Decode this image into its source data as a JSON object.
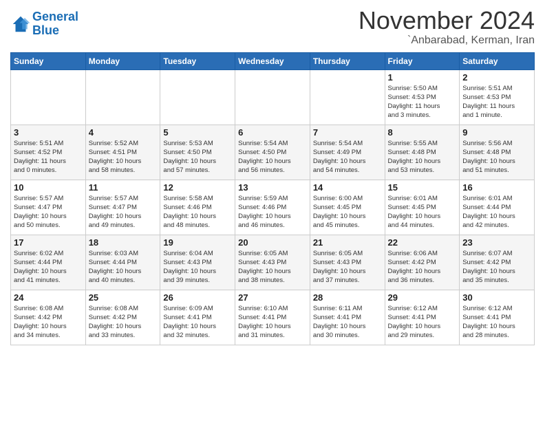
{
  "header": {
    "logo_line1": "General",
    "logo_line2": "Blue",
    "month": "November 2024",
    "location": "`Anbarabad, Kerman, Iran"
  },
  "weekdays": [
    "Sunday",
    "Monday",
    "Tuesday",
    "Wednesday",
    "Thursday",
    "Friday",
    "Saturday"
  ],
  "weeks": [
    [
      {
        "day": "",
        "info": ""
      },
      {
        "day": "",
        "info": ""
      },
      {
        "day": "",
        "info": ""
      },
      {
        "day": "",
        "info": ""
      },
      {
        "day": "",
        "info": ""
      },
      {
        "day": "1",
        "info": "Sunrise: 5:50 AM\nSunset: 4:53 PM\nDaylight: 11 hours\nand 3 minutes."
      },
      {
        "day": "2",
        "info": "Sunrise: 5:51 AM\nSunset: 4:53 PM\nDaylight: 11 hours\nand 1 minute."
      }
    ],
    [
      {
        "day": "3",
        "info": "Sunrise: 5:51 AM\nSunset: 4:52 PM\nDaylight: 11 hours\nand 0 minutes."
      },
      {
        "day": "4",
        "info": "Sunrise: 5:52 AM\nSunset: 4:51 PM\nDaylight: 10 hours\nand 58 minutes."
      },
      {
        "day": "5",
        "info": "Sunrise: 5:53 AM\nSunset: 4:50 PM\nDaylight: 10 hours\nand 57 minutes."
      },
      {
        "day": "6",
        "info": "Sunrise: 5:54 AM\nSunset: 4:50 PM\nDaylight: 10 hours\nand 56 minutes."
      },
      {
        "day": "7",
        "info": "Sunrise: 5:54 AM\nSunset: 4:49 PM\nDaylight: 10 hours\nand 54 minutes."
      },
      {
        "day": "8",
        "info": "Sunrise: 5:55 AM\nSunset: 4:48 PM\nDaylight: 10 hours\nand 53 minutes."
      },
      {
        "day": "9",
        "info": "Sunrise: 5:56 AM\nSunset: 4:48 PM\nDaylight: 10 hours\nand 51 minutes."
      }
    ],
    [
      {
        "day": "10",
        "info": "Sunrise: 5:57 AM\nSunset: 4:47 PM\nDaylight: 10 hours\nand 50 minutes."
      },
      {
        "day": "11",
        "info": "Sunrise: 5:57 AM\nSunset: 4:47 PM\nDaylight: 10 hours\nand 49 minutes."
      },
      {
        "day": "12",
        "info": "Sunrise: 5:58 AM\nSunset: 4:46 PM\nDaylight: 10 hours\nand 48 minutes."
      },
      {
        "day": "13",
        "info": "Sunrise: 5:59 AM\nSunset: 4:46 PM\nDaylight: 10 hours\nand 46 minutes."
      },
      {
        "day": "14",
        "info": "Sunrise: 6:00 AM\nSunset: 4:45 PM\nDaylight: 10 hours\nand 45 minutes."
      },
      {
        "day": "15",
        "info": "Sunrise: 6:01 AM\nSunset: 4:45 PM\nDaylight: 10 hours\nand 44 minutes."
      },
      {
        "day": "16",
        "info": "Sunrise: 6:01 AM\nSunset: 4:44 PM\nDaylight: 10 hours\nand 42 minutes."
      }
    ],
    [
      {
        "day": "17",
        "info": "Sunrise: 6:02 AM\nSunset: 4:44 PM\nDaylight: 10 hours\nand 41 minutes."
      },
      {
        "day": "18",
        "info": "Sunrise: 6:03 AM\nSunset: 4:44 PM\nDaylight: 10 hours\nand 40 minutes."
      },
      {
        "day": "19",
        "info": "Sunrise: 6:04 AM\nSunset: 4:43 PM\nDaylight: 10 hours\nand 39 minutes."
      },
      {
        "day": "20",
        "info": "Sunrise: 6:05 AM\nSunset: 4:43 PM\nDaylight: 10 hours\nand 38 minutes."
      },
      {
        "day": "21",
        "info": "Sunrise: 6:05 AM\nSunset: 4:43 PM\nDaylight: 10 hours\nand 37 minutes."
      },
      {
        "day": "22",
        "info": "Sunrise: 6:06 AM\nSunset: 4:42 PM\nDaylight: 10 hours\nand 36 minutes."
      },
      {
        "day": "23",
        "info": "Sunrise: 6:07 AM\nSunset: 4:42 PM\nDaylight: 10 hours\nand 35 minutes."
      }
    ],
    [
      {
        "day": "24",
        "info": "Sunrise: 6:08 AM\nSunset: 4:42 PM\nDaylight: 10 hours\nand 34 minutes."
      },
      {
        "day": "25",
        "info": "Sunrise: 6:08 AM\nSunset: 4:42 PM\nDaylight: 10 hours\nand 33 minutes."
      },
      {
        "day": "26",
        "info": "Sunrise: 6:09 AM\nSunset: 4:41 PM\nDaylight: 10 hours\nand 32 minutes."
      },
      {
        "day": "27",
        "info": "Sunrise: 6:10 AM\nSunset: 4:41 PM\nDaylight: 10 hours\nand 31 minutes."
      },
      {
        "day": "28",
        "info": "Sunrise: 6:11 AM\nSunset: 4:41 PM\nDaylight: 10 hours\nand 30 minutes."
      },
      {
        "day": "29",
        "info": "Sunrise: 6:12 AM\nSunset: 4:41 PM\nDaylight: 10 hours\nand 29 minutes."
      },
      {
        "day": "30",
        "info": "Sunrise: 6:12 AM\nSunset: 4:41 PM\nDaylight: 10 hours\nand 28 minutes."
      }
    ]
  ]
}
